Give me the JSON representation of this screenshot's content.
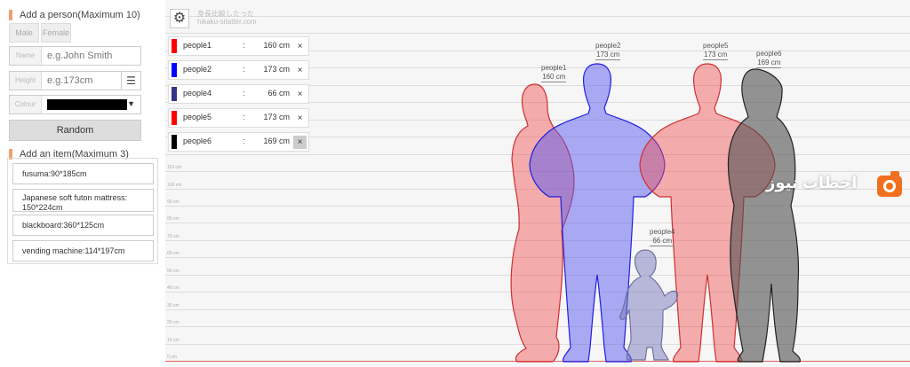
{
  "add_person": {
    "title": "Add a person(Maximum 10)",
    "male_tab": "Male",
    "female_tab": "Female",
    "name_label": "Name",
    "name_placeholder": "e.g.John Smith",
    "height_label": "Height",
    "height_placeholder": "e.g.173cm",
    "colour_label": "Colour",
    "colour_value": "#000000",
    "random_label": "Random"
  },
  "add_item": {
    "title": "Add an item(Maximum 3)",
    "items": [
      {
        "label": "fusuma:90*185cm"
      },
      {
        "label": "Japanese soft futon mattress: 150*224cm"
      },
      {
        "label": "blackboard:360*125cm"
      },
      {
        "label": "vending machine:114*197cm"
      }
    ]
  },
  "canvas": {
    "brand_line1": "身長比較したった",
    "brand_line2": "hikaku-sitatter.com",
    "ticks": [
      "110 cm",
      "100 cm",
      "90 cm",
      "80 cm",
      "70 cm",
      "60 cm",
      "50 cm",
      "40 cm",
      "30 cm",
      "20 cm",
      "10 cm",
      "0 cm"
    ],
    "people": [
      {
        "name": "people1",
        "height": "160 cm",
        "label": "160 cm",
        "color": "#ff0000"
      },
      {
        "name": "people2",
        "height": "173 cm",
        "label": "173 cm",
        "color": "#0000ff"
      },
      {
        "name": "people4",
        "height": "66 cm",
        "label": "66 cm",
        "color": "#333388"
      },
      {
        "name": "people5",
        "height": "173 cm",
        "label": "173 cm",
        "color": "#ff0000"
      },
      {
        "name": "people6",
        "height": "169 cm",
        "label": "169 cm",
        "color": "#000000"
      }
    ],
    "list_colon": ":",
    "close_icon": "×",
    "watermark": "احطات نيوز"
  }
}
